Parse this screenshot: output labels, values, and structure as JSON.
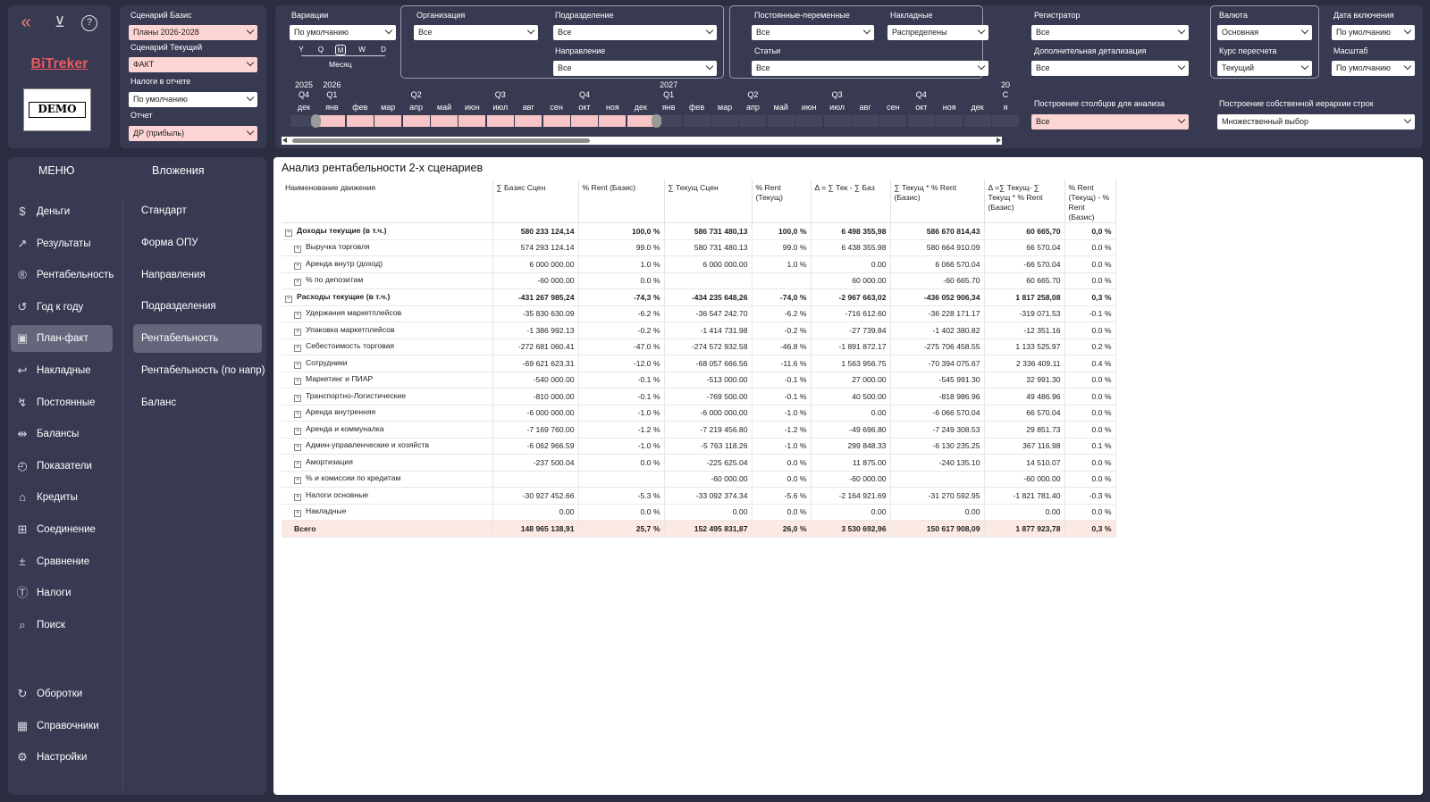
{
  "topbar": {
    "back_icon": "chevrons-left-icon",
    "filter_icon": "clear-filter-icon",
    "help_icon": "help-icon",
    "brand": "BiTreker",
    "logo_text": "DEMO"
  },
  "scenario": {
    "base_label": "Сценарий Базис",
    "base_value": "Планы 2026-2028",
    "current_label": "Сценарий Текущий",
    "current_value": "ФАКТ",
    "tax_label": "Налоги в отчете",
    "tax_value": "По умолчанию",
    "report_label": "Отчет",
    "report_value": "ДР (прибыль)"
  },
  "filters": {
    "variations_label": "Вариации",
    "variations_value": "По умолчанию",
    "org_label": "Организация",
    "org_value": "Все",
    "dept_label": "Подразделение",
    "dept_value": "Все",
    "direction_label": "Направление",
    "direction_value": "Все",
    "fixvar_label": "Постоянные-переменные",
    "fixvar_value": "Все",
    "overhead_label": "Накладные",
    "overhead_value": "Распределены",
    "articles_label": "Статьи",
    "articles_value": "Все",
    "registrar_label": "Регистратор",
    "registrar_value": "Все",
    "detail_label": "Дополнительная детализация",
    "detail_value": "Все",
    "currency_label": "Валюта",
    "currency_value": "Основная",
    "rate_label": "Курс пересчета",
    "rate_value": "Текущий",
    "incl_date_label": "Дата включения",
    "incl_date_value": "По умолчанию",
    "scale_label": "Масштаб",
    "scale_value": "По умолчанию",
    "columns_label": "Построение столбцов для анализа",
    "columns_value": "Все",
    "hierarchy_label": "Построение собственной иерархии строк",
    "hierarchy_value": "Множественный выбор"
  },
  "granularity": {
    "options": [
      "Y",
      "Q",
      "M",
      "W",
      "D"
    ],
    "selected": "M",
    "selected_label": "Месяц"
  },
  "timeline": {
    "years": [
      {
        "t": "2025",
        "i": 0
      },
      {
        "t": "2026",
        "i": 1
      },
      {
        "t": "2027",
        "i": 13
      },
      {
        "t": "20",
        "i": 25
      }
    ],
    "quarters": [
      {
        "t": "Q4",
        "i": 0
      },
      {
        "t": "Q1",
        "i": 1
      },
      {
        "t": "Q2",
        "i": 4
      },
      {
        "t": "Q3",
        "i": 7
      },
      {
        "t": "Q4",
        "i": 10
      },
      {
        "t": "Q1",
        "i": 13
      },
      {
        "t": "Q2",
        "i": 16
      },
      {
        "t": "Q3",
        "i": 19
      },
      {
        "t": "Q4",
        "i": 22
      },
      {
        "t": "C",
        "i": 25
      }
    ],
    "months": [
      "дек",
      "янв",
      "фев",
      "мар",
      "апр",
      "май",
      "июн",
      "июл",
      "авг",
      "сен",
      "окт",
      "ноя",
      "дек",
      "янв",
      "фев",
      "мар",
      "апр",
      "май",
      "июн",
      "июл",
      "авг",
      "сен",
      "окт",
      "ноя",
      "дек",
      "я"
    ],
    "selected_from": 1,
    "selected_to": 12
  },
  "menu": {
    "title": "МЕНЮ",
    "items": [
      {
        "label": "Деньги",
        "icon": "dollar-icon",
        "g": "$"
      },
      {
        "label": "Результаты",
        "icon": "line-chart-icon",
        "g": "↗"
      },
      {
        "label": "Рентабельность",
        "icon": "registered-icon",
        "g": "®"
      },
      {
        "label": "Год к году",
        "icon": "history-icon",
        "g": "↺"
      },
      {
        "label": "План-факт",
        "icon": "image-chart-icon",
        "g": "▣",
        "active": true
      },
      {
        "label": "Накладные",
        "icon": "return-icon",
        "g": "↩"
      },
      {
        "label": "Постоянные",
        "icon": "trending-icon",
        "g": "↯"
      },
      {
        "label": "Балансы",
        "icon": "compare-icon",
        "g": "⇹"
      },
      {
        "label": "Показатели",
        "icon": "clock-search-icon",
        "g": "◴"
      },
      {
        "label": "Кредиты",
        "icon": "bank-icon",
        "g": "⌂"
      },
      {
        "label": "Соединение",
        "icon": "merge-icon",
        "g": "⊞"
      },
      {
        "label": "Сравнение",
        "icon": "plus-minus-icon",
        "g": "±"
      },
      {
        "label": "Налоги",
        "icon": "tax-icon",
        "g": "Ⓣ"
      },
      {
        "label": "Поиск",
        "icon": "search-icon",
        "g": "⌕"
      }
    ],
    "bottom": [
      {
        "label": "Оборотки",
        "icon": "refresh-icon",
        "g": "↻"
      },
      {
        "label": "Справочники",
        "icon": "grid-icon",
        "g": "▦"
      },
      {
        "label": "Настройки",
        "icon": "gear-icon",
        "g": "⚙"
      }
    ]
  },
  "submenu": {
    "title": "Вложения",
    "items": [
      {
        "label": "Стандарт"
      },
      {
        "label": "Форма ОПУ"
      },
      {
        "label": "Направления"
      },
      {
        "label": "Подразделения"
      },
      {
        "label": "Рентабельность",
        "active": true
      },
      {
        "label": "Рентабельность (по напр)"
      },
      {
        "label": "Баланс"
      }
    ]
  },
  "report": {
    "title": "Анализ рентабельности 2-х сценариев",
    "columns": [
      "Наименование движения",
      "∑ Базис Сцен",
      "% Rent (Базис)",
      "∑ Текущ Сцен",
      "% Rent (Текущ)",
      "Δ = ∑ Тек - ∑ Баз",
      "∑ Текущ * % Rent (Базис)",
      "Δ =∑ Текущ- ∑ Текущ * % Rent (Базис)",
      "% Rent (Текущ) - % Rent (Базис)"
    ],
    "rows": [
      {
        "name": "Доходы текущие (в т.ч.)",
        "level": 0,
        "bold": true,
        "exp": "⊟",
        "v": [
          "580 233 124,14",
          "100,0 %",
          "586 731 480,13",
          "100,0 %",
          "6 498 355,98",
          "586 670 814,43",
          "60 665,70",
          "0,0 %"
        ]
      },
      {
        "name": "Выручка торговля",
        "level": 1,
        "exp": "⊞",
        "v": [
          "574 293 124.14",
          "99.0 %",
          "580 731 480.13",
          "99.0 %",
          "6 438 355.98",
          "580 664 910.09",
          "66 570.04",
          "0.0 %"
        ]
      },
      {
        "name": "Аренда внутр (доход)",
        "level": 1,
        "exp": "⊞",
        "v": [
          "6 000 000.00",
          "1.0 %",
          "6 000 000.00",
          "1.0 %",
          "0.00",
          "6 066 570.04",
          "-66 570.04",
          "0.0 %"
        ]
      },
      {
        "name": "% по депозитам",
        "level": 1,
        "exp": "⊞",
        "v": [
          "-60 000.00",
          "0.0 %",
          "",
          "",
          "60 000.00",
          "-60 665.70",
          "60 665.70",
          "0.0 %"
        ]
      },
      {
        "name": "Расходы текущие (в т.ч.)",
        "level": 0,
        "bold": true,
        "exp": "⊟",
        "v": [
          "-431 267 985,24",
          "-74,3 %",
          "-434 235 648,26",
          "-74,0 %",
          "-2 967 663,02",
          "-436 052 906,34",
          "1 817 258,08",
          "0,3 %"
        ]
      },
      {
        "name": "Удержания маркетплейсов",
        "level": 1,
        "exp": "⊞",
        "v": [
          "-35 830 630.09",
          "-6.2 %",
          "-36 547 242.70",
          "-6.2 %",
          "-716 612.60",
          "-36 228 171.17",
          "-319 071.53",
          "-0.1 %"
        ]
      },
      {
        "name": "Упаковка маркетплейсов",
        "level": 1,
        "exp": "⊞",
        "v": [
          "-1 386 992.13",
          "-0.2 %",
          "-1 414 731.98",
          "-0.2 %",
          "-27 739.84",
          "-1 402 380.82",
          "-12 351.16",
          "0.0 %"
        ]
      },
      {
        "name": "Себестоимость торговая",
        "level": 1,
        "exp": "⊞",
        "v": [
          "-272 681 060.41",
          "-47.0 %",
          "-274 572 932.58",
          "-46.8 %",
          "-1 891 872.17",
          "-275 706 458.55",
          "1 133 525.97",
          "0.2 %"
        ]
      },
      {
        "name": "Сотрудники",
        "level": 1,
        "exp": "⊞",
        "v": [
          "-69 621 623.31",
          "-12.0 %",
          "-68 057 666.56",
          "-11.6 %",
          "1 563 956.75",
          "-70 394 075.67",
          "2 336 409.11",
          "0.4 %"
        ]
      },
      {
        "name": "Маркетинг и ПИАР",
        "level": 1,
        "exp": "⊞",
        "v": [
          "-540 000.00",
          "-0.1 %",
          "-513 000.00",
          "-0.1 %",
          "27 000.00",
          "-545 991.30",
          "32 991.30",
          "0.0 %"
        ]
      },
      {
        "name": "Транспортно-Логистические",
        "level": 1,
        "exp": "⊞",
        "v": [
          "-810 000.00",
          "-0.1 %",
          "-769 500.00",
          "-0.1 %",
          "40 500.00",
          "-818 986.96",
          "49 486.96",
          "0.0 %"
        ]
      },
      {
        "name": "Аренда внутренняя",
        "level": 1,
        "exp": "⊞",
        "v": [
          "-6 000 000.00",
          "-1.0 %",
          "-6 000 000.00",
          "-1.0 %",
          "0.00",
          "-6 066 570.04",
          "66 570.04",
          "0.0 %"
        ]
      },
      {
        "name": "Аренда и коммуналка",
        "level": 1,
        "exp": "⊞",
        "v": [
          "-7 169 760.00",
          "-1.2 %",
          "-7 219 456.80",
          "-1.2 %",
          "-49 696.80",
          "-7 249 308.53",
          "29 851.73",
          "0.0 %"
        ]
      },
      {
        "name": "Админ-управленческие и хозяйств",
        "level": 1,
        "exp": "⊞",
        "v": [
          "-6 062 966.59",
          "-1.0 %",
          "-5 763 118.26",
          "-1.0 %",
          "299 848.33",
          "-6 130 235.25",
          "367 116.98",
          "0.1 %"
        ]
      },
      {
        "name": "Амортизация",
        "level": 1,
        "exp": "⊞",
        "v": [
          "-237 500.04",
          "0.0 %",
          "-225 625.04",
          "0.0 %",
          "11 875.00",
          "-240 135.10",
          "14 510.07",
          "0.0 %"
        ]
      },
      {
        "name": "% и комиссии по кредитам",
        "level": 1,
        "exp": "⊞",
        "v": [
          "",
          "",
          "-60 000.00",
          "0.0 %",
          "-60 000.00",
          "",
          "-60 000.00",
          "0.0 %"
        ]
      },
      {
        "name": "Налоги основные",
        "level": 1,
        "exp": "⊞",
        "v": [
          "-30 927 452.66",
          "-5.3 %",
          "-33 092 374.34",
          "-5.6 %",
          "-2 164 921.69",
          "-31 270 592.95",
          "-1 821 781.40",
          "-0.3 %"
        ]
      },
      {
        "name": "Накладные",
        "level": 1,
        "exp": "⊞",
        "v": [
          "0.00",
          "0.0 %",
          "0.00",
          "0.0 %",
          "0.00",
          "0.00",
          "0.00",
          "0.0 %"
        ]
      },
      {
        "name": "Всего",
        "level": 0,
        "total": true,
        "exp": "",
        "v": [
          "148 965 138,91",
          "25,7 %",
          "152 495 831,87",
          "26,0 %",
          "3 530 692,96",
          "150 617 908,09",
          "1 877 923,78",
          "0,3 %"
        ]
      }
    ]
  }
}
